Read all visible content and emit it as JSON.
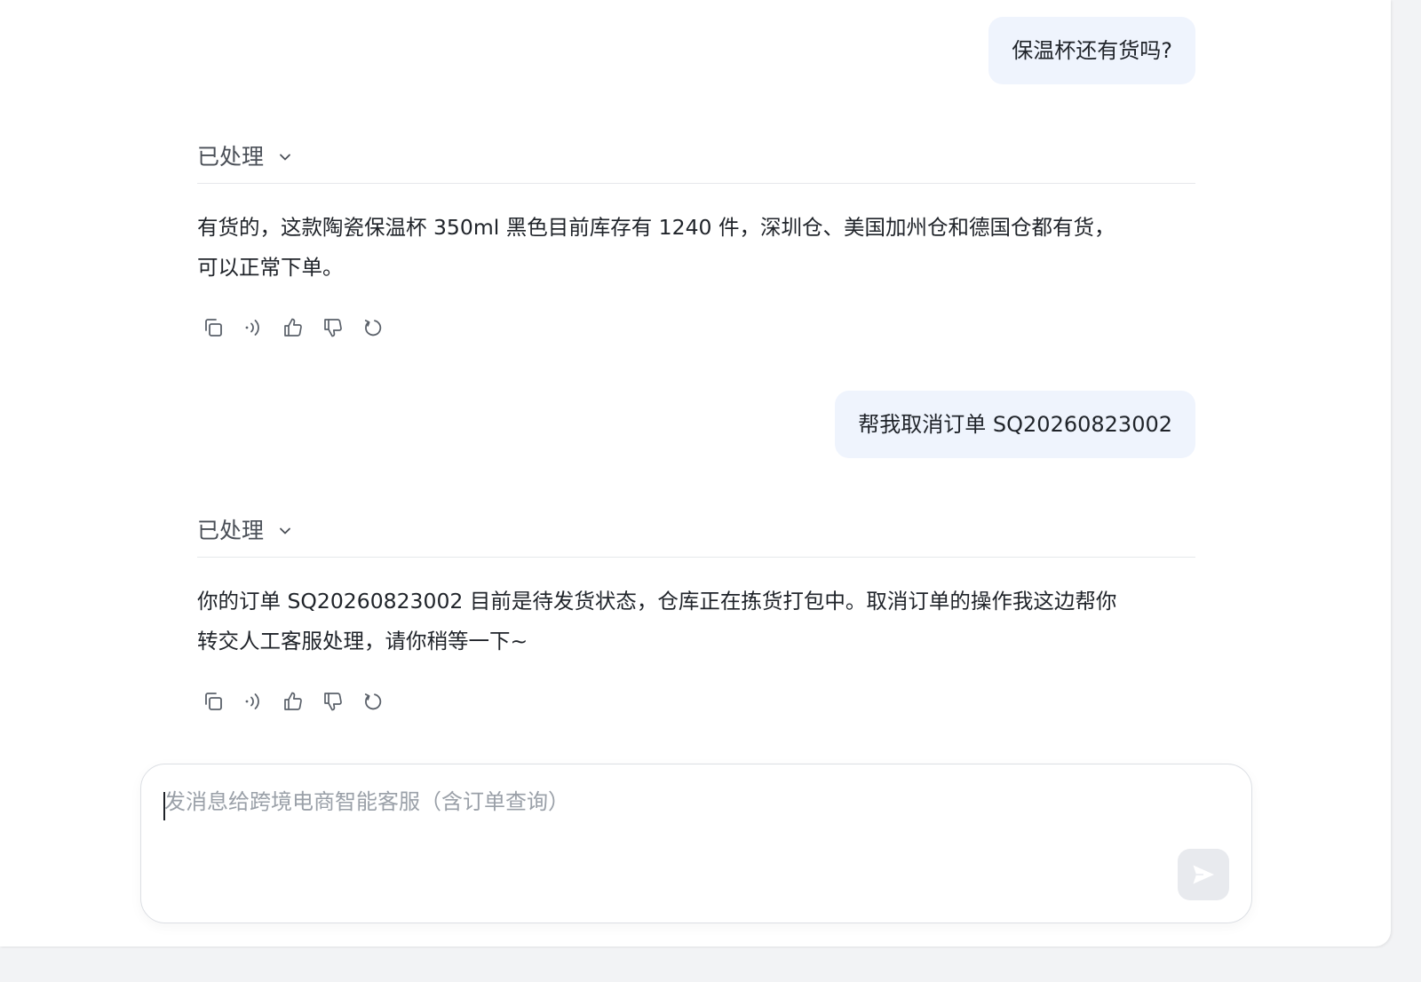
{
  "conversation": {
    "messages": [
      {
        "role": "user",
        "text": "保温杯还有货吗?"
      },
      {
        "role": "assistant",
        "status_label": "已处理",
        "paragraph_lines": [
          "有货的，这款陶瓷保温杯 350ml 黑色目前库存有 1240 件，深圳仓、美国加州仓和德国仓都有货，",
          "可以正常下单。"
        ]
      },
      {
        "role": "user",
        "text": "帮我取消订单 SQ20260823002"
      },
      {
        "role": "assistant",
        "status_label": "已处理",
        "paragraph_lines": [
          "你的订单 SQ20260823002 目前是待发货状态，仓库正在拣货打包中。取消订单的操作我这边帮你",
          "转交人工客服处理，请你稍等一下~"
        ]
      }
    ],
    "action_icons": [
      "copy-icon",
      "speaker-icon",
      "thumbs-up-icon",
      "thumbs-down-icon",
      "regenerate-icon"
    ]
  },
  "composer": {
    "value": "",
    "placeholder": "发消息给跨境电商智能客服（含订单查询）",
    "send_icon": "send-icon"
  },
  "colors": {
    "user_bubble": "#eff4fd",
    "text": "#1f2329",
    "icon": "#5a6069",
    "send_disabled": "#e8eaee"
  }
}
